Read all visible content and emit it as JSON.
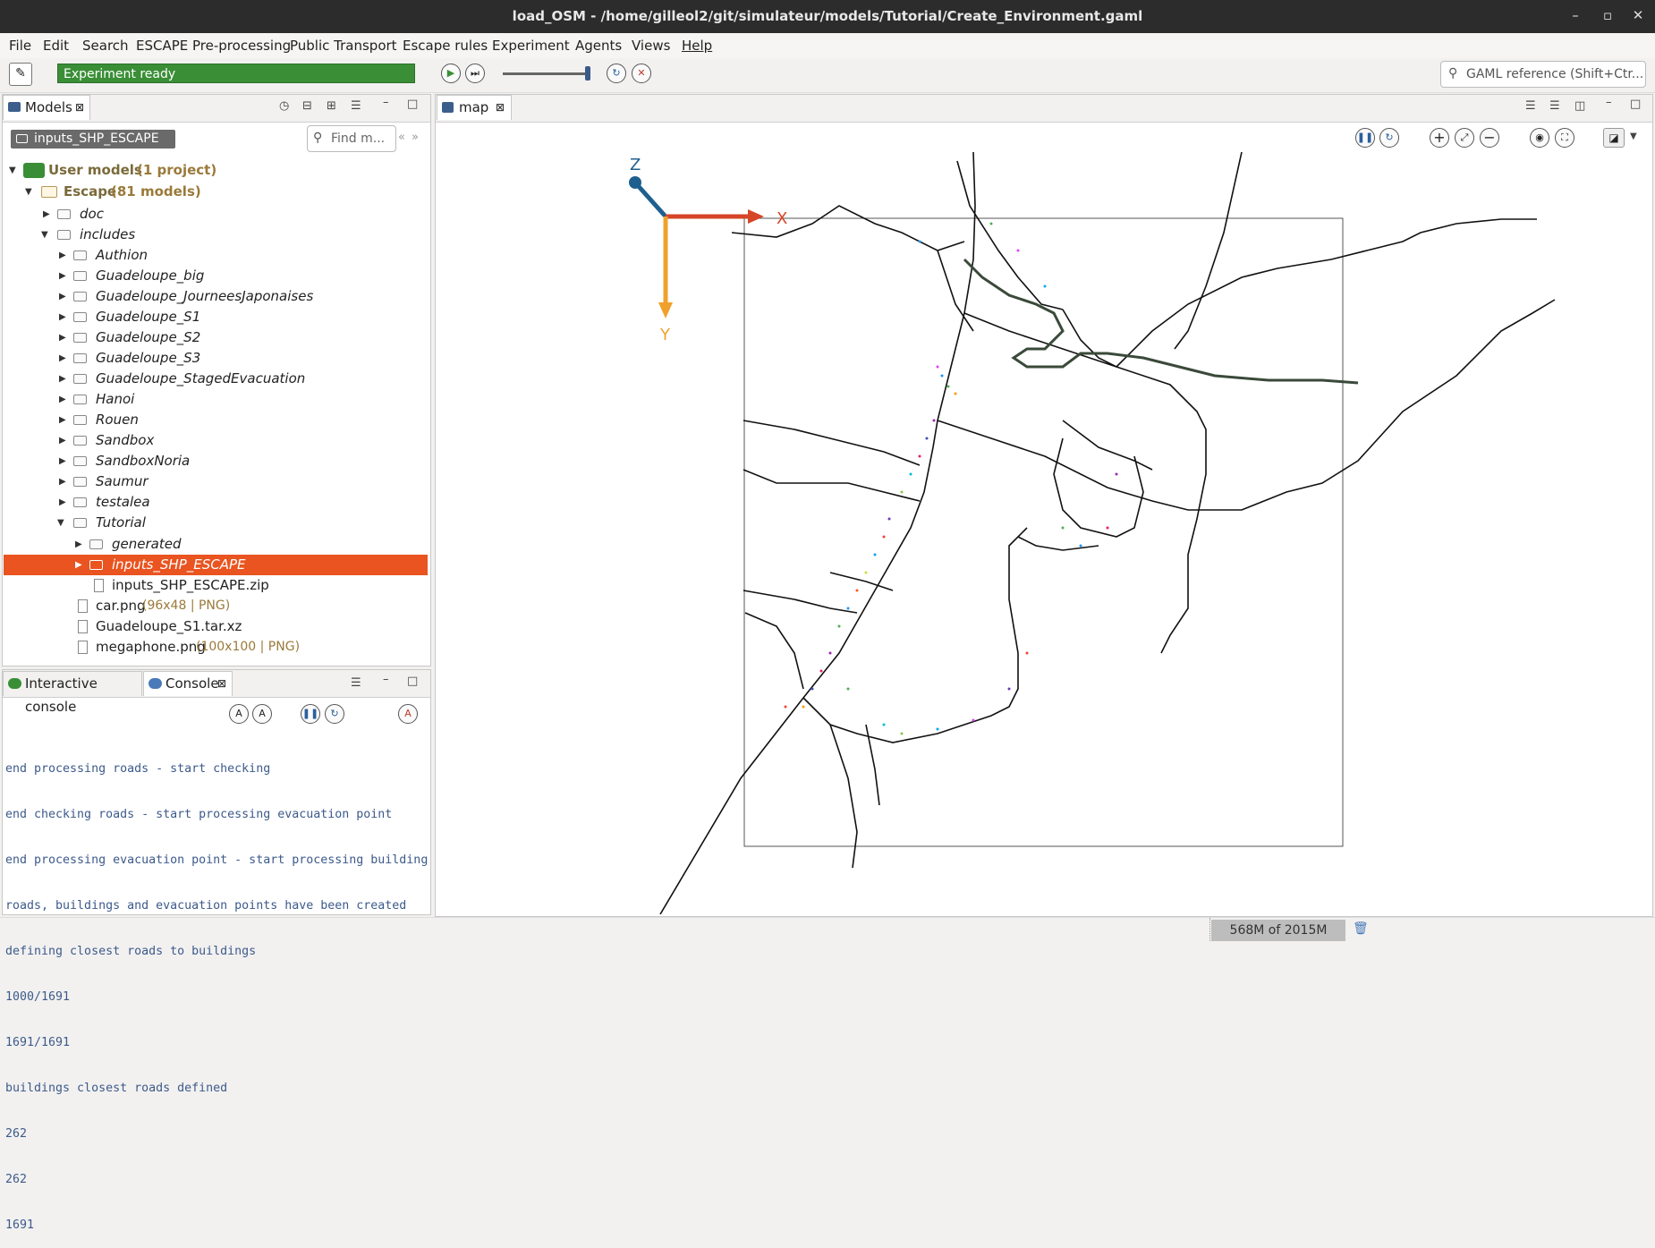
{
  "window": {
    "title": "load_OSM - /home/gilleol2/git/simulateur/models/Tutorial/Create_Environment.gaml"
  },
  "menu": [
    "File",
    "Edit",
    "Search",
    "ESCAPE Pre-processing",
    "Public Transport",
    "Escape rules",
    "Experiment",
    "Agents",
    "Views",
    "Help"
  ],
  "toolbar": {
    "status": "Experiment ready",
    "search_placeholder": "GAML reference (Shift+Ctr..."
  },
  "models_panel": {
    "tab": "Models",
    "breadcrumb": "inputs_SHP_ESCAPE",
    "find_placeholder": "Find m...",
    "tree": [
      {
        "label": "User models",
        "meta": " (1 project)"
      },
      {
        "label": "Escape",
        "meta": " (81 models)"
      },
      {
        "label": "doc"
      },
      {
        "label": "includes"
      },
      {
        "label": "Authion"
      },
      {
        "label": "Guadeloupe_big"
      },
      {
        "label": "Guadeloupe_JourneesJaponaises"
      },
      {
        "label": "Guadeloupe_S1"
      },
      {
        "label": "Guadeloupe_S2"
      },
      {
        "label": "Guadeloupe_S3"
      },
      {
        "label": "Guadeloupe_StagedEvacuation"
      },
      {
        "label": "Hanoi"
      },
      {
        "label": "Rouen"
      },
      {
        "label": "Sandbox"
      },
      {
        "label": "SandboxNoria"
      },
      {
        "label": "Saumur"
      },
      {
        "label": "testalea"
      },
      {
        "label": "Tutorial"
      },
      {
        "label": "generated"
      },
      {
        "label": "inputs_SHP_ESCAPE"
      },
      {
        "label": "inputs_SHP_ESCAPE.zip"
      },
      {
        "label": "car.png",
        "meta": " (96x48 | PNG)"
      },
      {
        "label": "Guadeloupe_S1.tar.xz"
      },
      {
        "label": "megaphone.png",
        "meta": " (100x100 | PNG)"
      }
    ]
  },
  "console_panel": {
    "tabs": [
      "Interactive console",
      "Console"
    ],
    "lines": [
      "end processing roads - start checking",
      "end checking roads - start processing evacuation point",
      "end processing evacuation point - start processing building",
      "roads, buildings and evacuation points have been created",
      "defining closest roads to buildings",
      "1000/1691",
      "1691/1691",
      "buildings closest roads defined",
      "262",
      "262",
      "1691"
    ]
  },
  "map_panel": {
    "tab": "map",
    "axis_x": "X",
    "axis_y": "Y",
    "axis_z": "Z"
  },
  "statusbar": {
    "memory": "568M of 2015M"
  },
  "colors": {
    "accent": "#e95420",
    "status_green": "#3a8e36",
    "axis_x": "#d64528",
    "axis_y": "#f0a12c",
    "axis_z": "#1f5f8f"
  }
}
